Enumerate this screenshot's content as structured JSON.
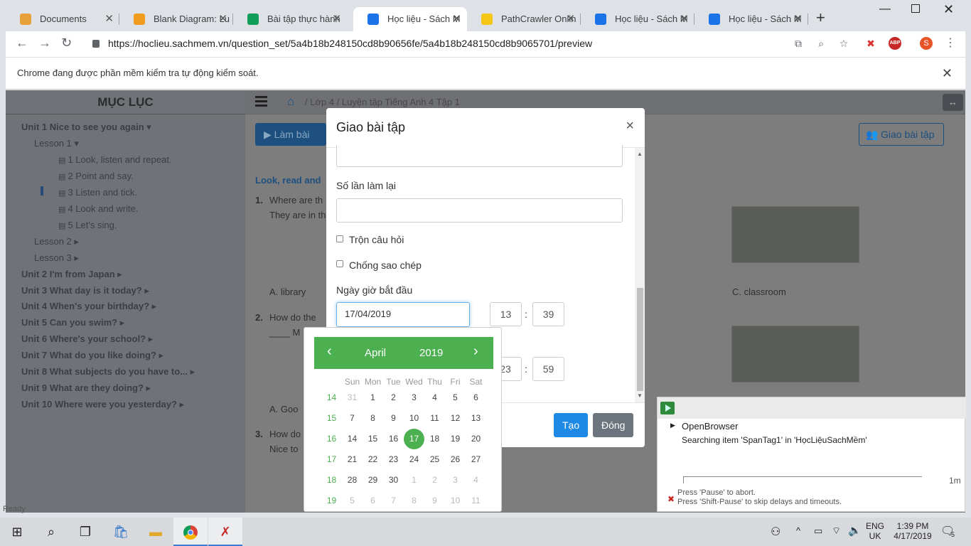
{
  "browser": {
    "tabs": [
      {
        "label": "Documents",
        "color": "#e8a13a"
      },
      {
        "label": "Blank Diagram: Lu",
        "color": "#f29c1f"
      },
      {
        "label": "Bài tập thực hành",
        "color": "#0f9d58"
      },
      {
        "label": "Học liệu - Sách M",
        "color": "#1a73e8",
        "active": true
      },
      {
        "label": "PathCrawler Onlin",
        "color": "#f5c518"
      },
      {
        "label": "Học liệu - Sách M",
        "color": "#1a73e8"
      },
      {
        "label": "Học liệu - Sách M",
        "color": "#1a73e8"
      }
    ],
    "new_tab_glyph": "+",
    "url": "https://hoclieu.sachmem.vn/question_set/5a4b18b248150cd8b90656fe/5a4b18b248150cd8b9065701/preview",
    "profile_initial": "S",
    "abp_label": "ABP",
    "infobar_text": "Chrome đang được phần mềm kiểm tra tự động kiểm soát."
  },
  "sidebar": {
    "title": "MỤC LỤC",
    "items": [
      {
        "label": "Unit 1 Nice to see you again ▾",
        "unit": true
      },
      {
        "label": "Lesson 1 ▾"
      },
      {
        "label": "1 Look, listen and repeat."
      },
      {
        "label": "2 Point and say."
      },
      {
        "label": "3 Listen and tick."
      },
      {
        "label": "4 Look and write."
      },
      {
        "label": "5 Let's sing."
      },
      {
        "label": "Lesson 2 ▸"
      },
      {
        "label": "Lesson 3 ▸"
      },
      {
        "label": "Unit 2 I'm from Japan ▸",
        "unit": true
      },
      {
        "label": "Unit 3 What day is it today? ▸",
        "unit": true
      },
      {
        "label": "Unit 4 When's your birthday? ▸",
        "unit": true
      },
      {
        "label": "Unit 5 Can you swim? ▸",
        "unit": true
      },
      {
        "label": "Unit 6 Where's your school? ▸",
        "unit": true
      },
      {
        "label": "Unit 7 What do you like doing? ▸",
        "unit": true
      },
      {
        "label": "Unit 8 What subjects do you have to... ▸",
        "unit": true
      },
      {
        "label": "Unit 9 What are they doing? ▸",
        "unit": true
      },
      {
        "label": "Unit 10 Where were you yesterday? ▸",
        "unit": true
      }
    ]
  },
  "content": {
    "breadcrumb": [
      "Lớp 4",
      "Luyện tập Tiếng Anh 4 Tập 1"
    ],
    "lam_bai_label": "▶ Làm bài",
    "giao_bai_tap_label": "Giao bài tập",
    "instruction": "Look, read and",
    "q1_num": "1.",
    "q1_line1": "Where are th",
    "q1_line2": "They are in th",
    "q1_opt_a": "A. library",
    "q1_opt_c": "C. classroom",
    "q2_num": "2.",
    "q2_line1": "How do the",
    "q2_line2": "____ M",
    "q2_opt_a": "A. Goo",
    "q3_num": "3.",
    "q3_line1": "How do",
    "q3_line2": "Nice to"
  },
  "modal": {
    "title": "Giao bài tập",
    "close_glyph": "×",
    "retries_label": "Số lần làm lại",
    "shuffle_label": "Trộn câu hỏi",
    "anticopy_label": "Chống sao chép",
    "start_label": "Ngày giờ bắt đầu",
    "start_date": "17/04/2019",
    "start_hour": "13",
    "start_minute": "39",
    "end_hour": "23",
    "end_minute": "59",
    "colon": ":",
    "create_label": "Tạo",
    "close_label": "Đóng"
  },
  "datepicker": {
    "prev": "‹",
    "next": "›",
    "month": "April",
    "year": "2019",
    "weekdays": [
      "Sun",
      "Mon",
      "Tue",
      "Wed",
      "Thu",
      "Fri",
      "Sat"
    ],
    "weeks": [
      {
        "wk": "14",
        "days": [
          "31",
          "1",
          "2",
          "3",
          "4",
          "5",
          "6"
        ]
      },
      {
        "wk": "15",
        "days": [
          "7",
          "8",
          "9",
          "10",
          "11",
          "12",
          "13"
        ]
      },
      {
        "wk": "16",
        "days": [
          "14",
          "15",
          "16",
          "17",
          "18",
          "19",
          "20"
        ]
      },
      {
        "wk": "17",
        "days": [
          "21",
          "22",
          "23",
          "24",
          "25",
          "26",
          "27"
        ]
      },
      {
        "wk": "18",
        "days": [
          "28",
          "29",
          "30",
          "1",
          "2",
          "3",
          "4"
        ]
      },
      {
        "wk": "19",
        "days": [
          "5",
          "6",
          "7",
          "8",
          "9",
          "10",
          "11"
        ]
      }
    ],
    "selected": "17",
    "accent": "#4caf50"
  },
  "robot": {
    "step": "OpenBrowser",
    "status": "Searching item 'SpanTag1' in 'HọcLiệuSachMềm'",
    "timeout": "1m",
    "hint1": "Press 'Pause' to abort.",
    "hint2": "Press 'Shift-Pause' to skip delays and timeouts."
  },
  "taskbar": {
    "status_text": "Ready",
    "lang1": "ENG",
    "lang2": "UK",
    "time": "1:39 PM",
    "date": "4/17/2019",
    "notif_count": "5"
  }
}
